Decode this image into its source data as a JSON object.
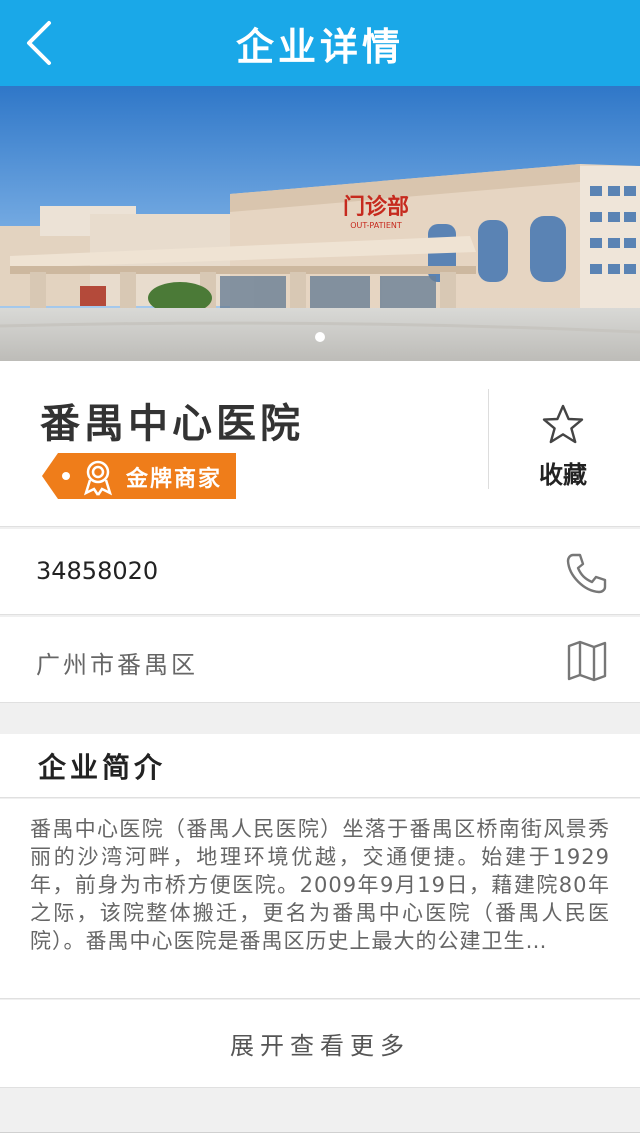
{
  "nav": {
    "title": "企业详情",
    "back_icon": "back-chevron-icon"
  },
  "banner": {
    "sign_text": "门诊部",
    "sign_subtext": "OUT-PATIENT",
    "slide_count": 1,
    "active_slide": 1
  },
  "company": {
    "name": "番禺中心医院",
    "badge": "金牌商家",
    "badge_color": "#ef7d1a",
    "favorite_label": "收藏"
  },
  "contact": {
    "phone": "34858020",
    "address": "广州市番禺区"
  },
  "intro": {
    "title": "企业简介",
    "text": "番禺中心医院（番禺人民医院）坐落于番禺区桥南街风景秀丽的沙湾河畔，地理环境优越，交通便捷。始建于1929年，前身为市桥方便医院。2009年9月19日，藉建院80年之际，该院整体搬迁，更名为番禺中心医院（番禺人民医院）。番禺中心医院是番禺区历史上最大的公建卫生…",
    "expand_label": "展开查看更多"
  },
  "colors": {
    "accent": "#1aa8e8",
    "badge": "#ef7d1a"
  }
}
